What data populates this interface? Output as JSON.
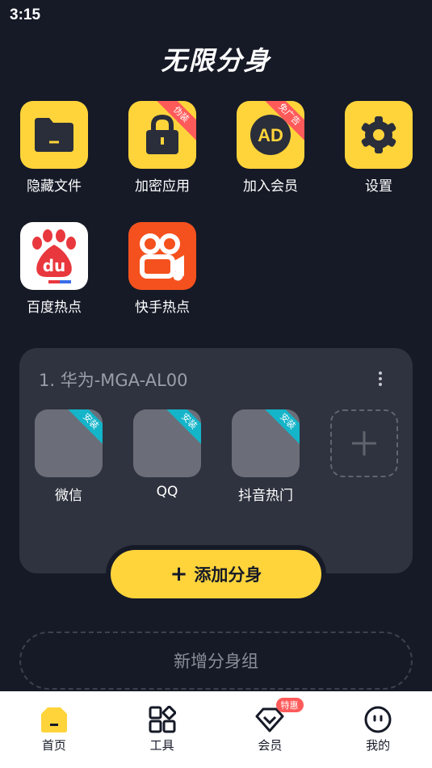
{
  "status_bar": {
    "time": "3:15"
  },
  "header": {
    "title": "无限分身"
  },
  "tools": [
    {
      "label": "隐藏文件",
      "icon": "folder-icon"
    },
    {
      "label": "加密应用",
      "icon": "lock-icon",
      "ribbon": "伪装"
    },
    {
      "label": "加入会员",
      "icon": "ad-icon",
      "ribbon": "免广告"
    },
    {
      "label": "设置",
      "icon": "gear-icon"
    },
    {
      "label": "百度热点",
      "icon": "baidu-icon"
    },
    {
      "label": "快手热点",
      "icon": "kuaishou-icon"
    }
  ],
  "group": {
    "title": "1. 华为-MGA-AL00",
    "apps": [
      {
        "label": "微信",
        "ribbon": "安装"
      },
      {
        "label": "QQ",
        "ribbon": "安装"
      },
      {
        "label": "抖音热门",
        "ribbon": "安装"
      }
    ],
    "add_button_label": "添加分身"
  },
  "new_group_label": "新增分身组",
  "tabbar": {
    "items": [
      {
        "label": "首页",
        "icon": "home-icon",
        "active": true
      },
      {
        "label": "工具",
        "icon": "grid-icon"
      },
      {
        "label": "会员",
        "icon": "vip-icon",
        "badge": "特惠"
      },
      {
        "label": "我的",
        "icon": "profile-icon"
      }
    ]
  },
  "colors": {
    "background": "#161a27",
    "accent": "#ffd43b",
    "card": "#2f333f",
    "badge": "#ff5a5a",
    "install_ribbon": "#14b4c9"
  }
}
